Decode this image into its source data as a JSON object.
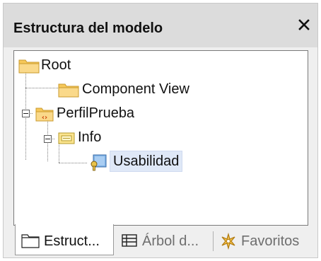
{
  "panel": {
    "title": "Estructura del modelo",
    "close_glyph": "✕"
  },
  "tree": {
    "nodes": [
      {
        "label": "Root",
        "icon": "folder-icon",
        "expanded": true
      },
      {
        "label": "Component View",
        "icon": "folder-icon"
      },
      {
        "label": "PerfilPrueba",
        "icon": "profile-package-icon",
        "expanded": true
      },
      {
        "label": "Info",
        "icon": "package-icon",
        "expanded": true
      },
      {
        "label": "Usabilidad",
        "icon": "stereotype-icon",
        "selected": true
      }
    ]
  },
  "tabs": [
    {
      "label": "Estruct...",
      "icon": "folder-icon",
      "active": true
    },
    {
      "label": "Árbol d...",
      "icon": "tree-icon",
      "active": false
    },
    {
      "label": "Favoritos",
      "icon": "favorites-icon",
      "active": false
    }
  ],
  "colors": {
    "panel_bg": "#efefef",
    "selection_bg": "#dfe8f7",
    "folder_yellow": "#f6c85a"
  }
}
